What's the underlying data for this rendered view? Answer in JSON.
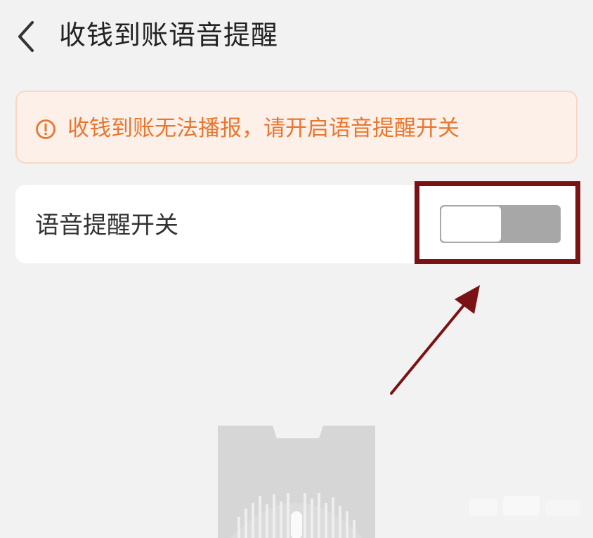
{
  "header": {
    "title": "收钱到账语音提醒",
    "back_icon": "chevron-left-icon"
  },
  "warning": {
    "icon": "exclamation-circle-icon",
    "text": "收钱到账无法播报，请开启语音提醒开关",
    "color": "#e9762f",
    "background": "#fcf0e8"
  },
  "settings": {
    "voice_switch_label": "语音提醒开关",
    "voice_switch_on": false
  },
  "annotation": {
    "color": "#7a1214"
  }
}
